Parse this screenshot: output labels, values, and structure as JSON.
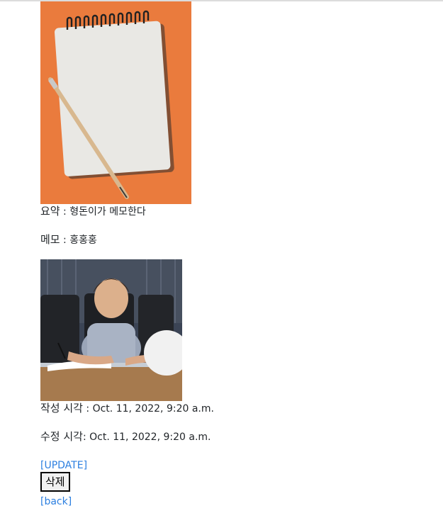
{
  "post": {
    "notebook_image": "notebook-with-pencil-image",
    "summary_label": "요약",
    "summary_sep": " : ",
    "summary_value": "형돈이가 메모한다",
    "memo_label": "메모",
    "memo_sep": " : ",
    "memo_value": "홍홍홍",
    "person_image": "person-writing-photo",
    "created_label": "작성 시각",
    "created_sep": " : ",
    "created_value": "Oct. 11, 2022, 9:20 a.m.",
    "updated_label": "수정 시각",
    "updated_sep": ": ",
    "updated_value": "Oct. 11, 2022, 9:20 a.m."
  },
  "actions": {
    "update_link": "[UPDATE]",
    "delete_button": "삭제",
    "back_link": "[back]"
  },
  "colors": {
    "link": "#2c7fe0",
    "notebook_bg": "#e8783c"
  }
}
